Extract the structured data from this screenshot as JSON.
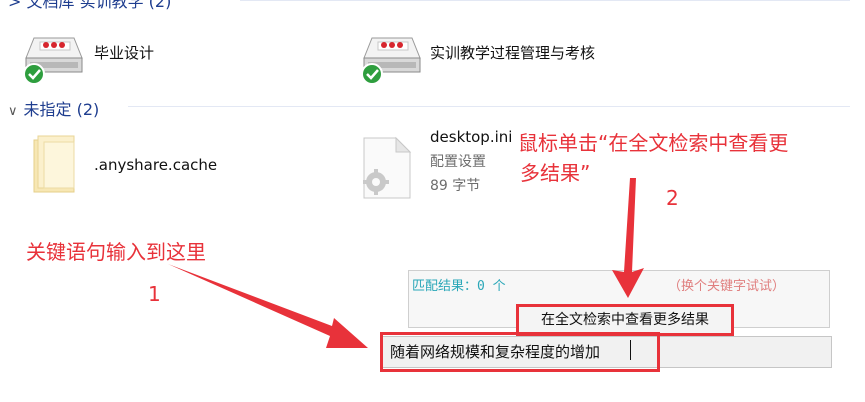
{
  "groups": [
    {
      "header": "> 文档库 实训教学 (2)",
      "items": [
        {
          "label": "毕业设计",
          "icon": "network-drive-synced-icon"
        },
        {
          "label": "实训教学过程管理与考核",
          "icon": "network-drive-synced-icon"
        }
      ]
    },
    {
      "header": "未指定 (2)",
      "items": [
        {
          "label": ".anyshare.cache",
          "icon": "folder-icon"
        },
        {
          "label": "desktop.ini",
          "type": "配置设置",
          "size": "89 字节",
          "icon": "config-file-icon"
        }
      ]
    }
  ],
  "annotations": {
    "step1_text": "关键语句输入到这里",
    "step1_number": "1",
    "step2_text_line1": "鼠标单击“在全文检索中查看更",
    "step2_text_line2": "多结果”",
    "step2_number": "2"
  },
  "search_panel": {
    "match_label": "匹配结果：0 个",
    "hint": "（换个关键字试试）",
    "fulltext_button": "在全文检索中查看更多结果",
    "query": "随着网络规模和复杂程度的增加"
  },
  "colors": {
    "annotation": "#e8323a",
    "group_header": "#1e3d8f",
    "match_text": "#2aa7b8",
    "hint_text": "#e07f7f",
    "sync_check": "#2e9e3e"
  }
}
